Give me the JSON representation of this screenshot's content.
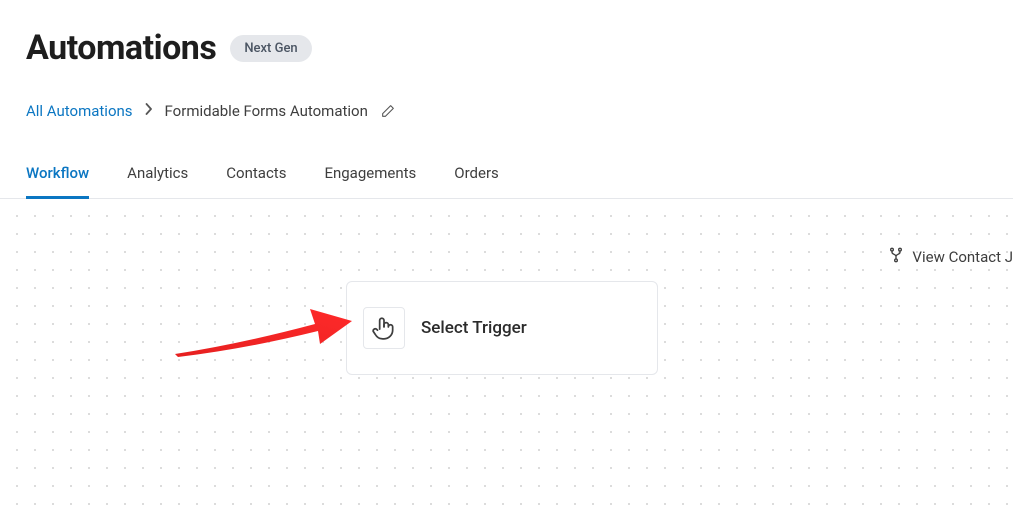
{
  "header": {
    "title": "Automations",
    "pill": "Next Gen"
  },
  "breadcrumb": {
    "root": "All Automations",
    "current": "Formidable Forms Automation"
  },
  "tabs": [
    {
      "label": "Workflow",
      "active": true
    },
    {
      "label": "Analytics",
      "active": false
    },
    {
      "label": "Contacts",
      "active": false
    },
    {
      "label": "Engagements",
      "active": false
    },
    {
      "label": "Orders",
      "active": false
    }
  ],
  "canvas": {
    "view_contact_label": "View Contact J",
    "trigger_card_label": "Select Trigger"
  }
}
